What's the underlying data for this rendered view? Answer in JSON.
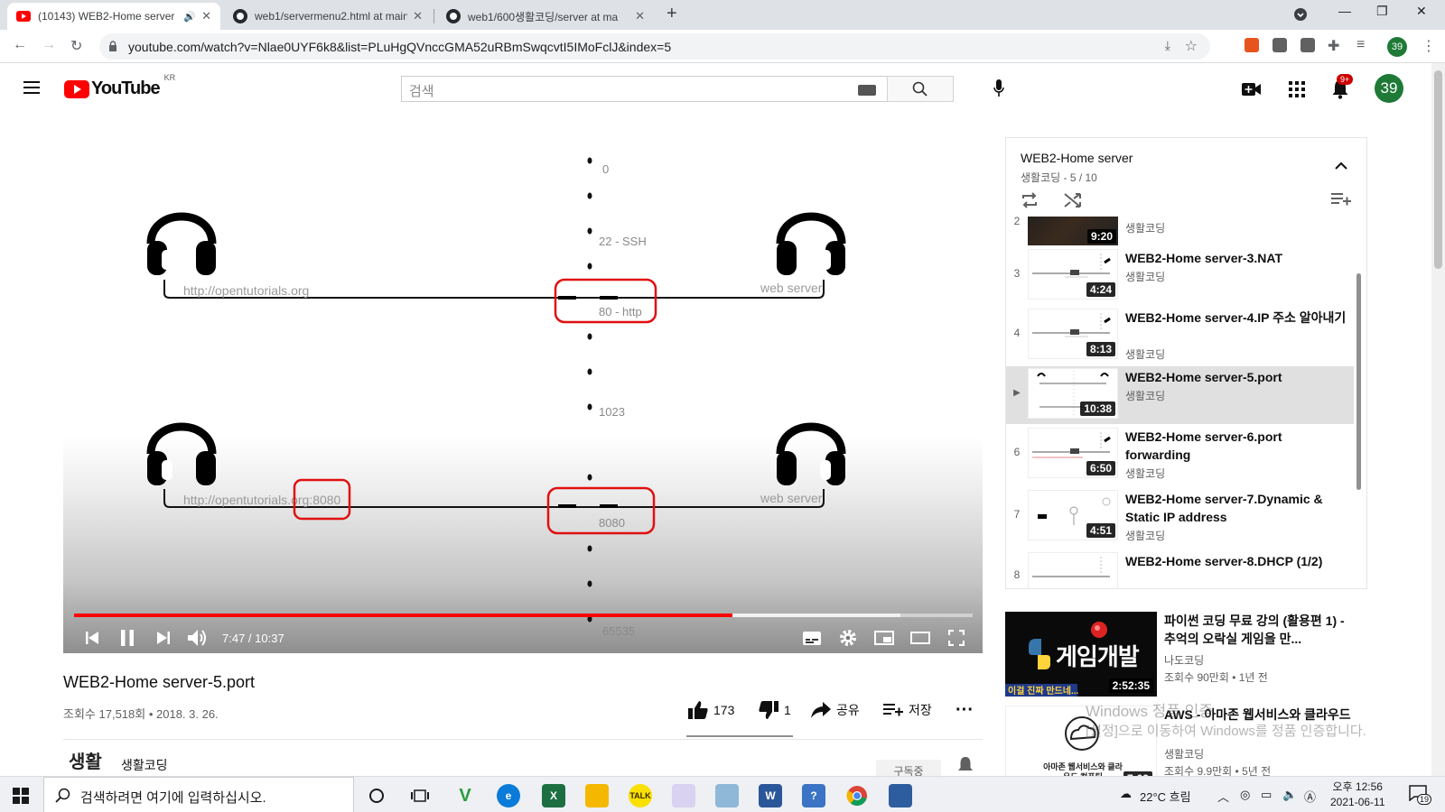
{
  "browser": {
    "tabs": [
      {
        "title": "(10143) WEB2-Home server",
        "active": true
      },
      {
        "title": "web1/servermenu2.html at main",
        "active": false
      },
      {
        "title": "web1/600생활코딩/server at ma",
        "active": false
      }
    ],
    "url": "youtube.com/watch?v=Nlae0UYF6k8&list=PLuHgQVnccGMA52uRBmSwqcvtI5IMoFclJ&index=5",
    "profile_badge": "39"
  },
  "header": {
    "logo_text": "YouTube",
    "region": "KR",
    "search_placeholder": "검색",
    "notification_badge": "9+",
    "avatar_letter": "39"
  },
  "player": {
    "diagram": {
      "port_labels": [
        "0",
        "22 - SSH",
        "80 - http",
        "1023",
        "8080",
        "65535"
      ],
      "client_label_1": "http://opentutorials.org",
      "client_label_2": "http://opentutorials.org:8080",
      "server_label_1": "web server",
      "server_label_2": "web server"
    },
    "current_time": "7:47",
    "duration": "10:37",
    "played_fraction": 0.733,
    "buffered_fraction": 0.92
  },
  "video": {
    "title": "WEB2-Home server-5.port",
    "views": "조회수 17,518회",
    "date": "2018. 3. 26.",
    "likes": "173",
    "dislikes": "1",
    "share_label": "공유",
    "save_label": "저장",
    "channel_logo": "생활",
    "channel_name": "생활코딩",
    "subscribe_label": "구독중"
  },
  "playlist": {
    "title": "WEB2-Home server",
    "subtitle": "생활코딩 - 5 / 10",
    "items": [
      {
        "index": "2",
        "title": "",
        "channel": "생활코딩",
        "duration": "9:20"
      },
      {
        "index": "3",
        "title": "WEB2-Home server-3.NAT",
        "channel": "생활코딩",
        "duration": "4:24"
      },
      {
        "index": "4",
        "title": "WEB2-Home server-4.IP 주소 알아내기",
        "channel": "생활코딩",
        "duration": "8:13"
      },
      {
        "index": "▶",
        "title": "WEB2-Home server-5.port",
        "channel": "생활코딩",
        "duration": "10:38"
      },
      {
        "index": "6",
        "title": "WEB2-Home server-6.port forwarding",
        "channel": "생활코딩",
        "duration": "6:50"
      },
      {
        "index": "7",
        "title": "WEB2-Home server-7.Dynamic & Static IP address",
        "channel": "생활코딩",
        "duration": "4:51"
      },
      {
        "index": "8",
        "title": "WEB2-Home server-8.DHCP (1/2)",
        "channel": "생활코딩",
        "duration": ""
      }
    ]
  },
  "recommendations": [
    {
      "title": "파이썬 코딩 무료 강의 (활용편 1) - 추억의 오락실 게임을 만...",
      "channel": "나도코딩",
      "stats": "조회수 90만회 • 1년 전",
      "duration": "2:52:35",
      "thumb_text": "게임개발",
      "thumb_caption": "이걸 진짜 만드네..."
    },
    {
      "title": "AWS - 아마존 웹서비스와 클라우드",
      "channel": "생활코딩",
      "stats": "조회수 9.9만회 • 5년 전",
      "duration": "7:09",
      "thumb_text": "아마존 웹서비스와 클라우드 컴퓨팅"
    }
  ],
  "watermark": {
    "line1": "Windows 정품 인증",
    "line2": "[설정]으로 이동하여 Windows를 정품 인증합니다."
  },
  "taskbar": {
    "search_text": "검색하려면 여기에 입력하십시오.",
    "weather": "22°C 흐림",
    "time": "오후 12:56",
    "date": "2021-06-11",
    "notifications": "19"
  }
}
